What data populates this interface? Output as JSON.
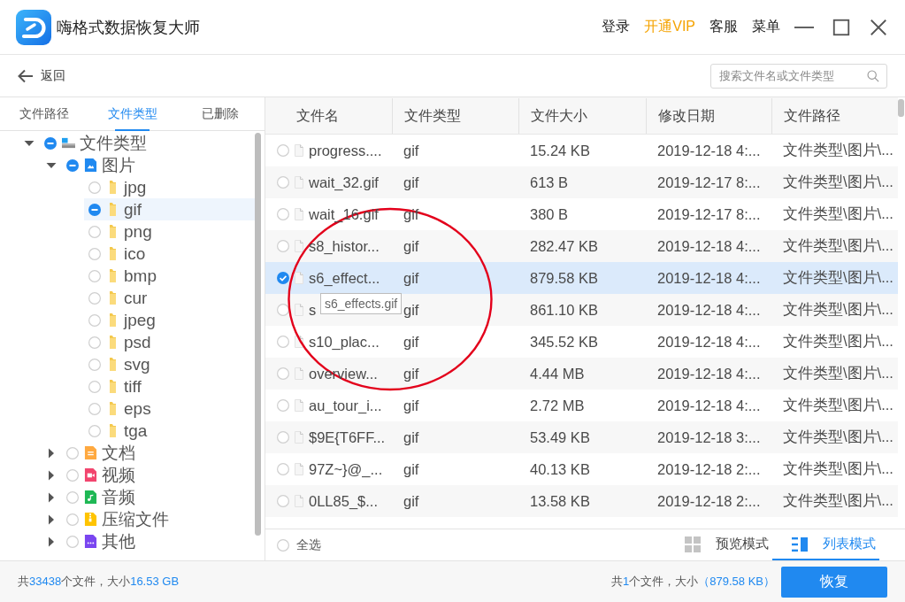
{
  "app": {
    "title": "嗨格式数据恢复大师",
    "nav": [
      {
        "label": "登录",
        "kind": "link"
      },
      {
        "label": "开通VIP",
        "kind": "vip"
      },
      {
        "label": "客服",
        "kind": "link"
      },
      {
        "label": "菜单",
        "kind": "link"
      }
    ]
  },
  "toolbar": {
    "back_label": "返回",
    "search": {
      "placeholder": "搜索文件名或文件类型"
    }
  },
  "sidebar": {
    "tabs": [
      {
        "label": "文件路径",
        "selected": false
      },
      {
        "label": "文件类型",
        "selected": true
      },
      {
        "label": "已删除",
        "selected": false
      }
    ],
    "tree": [
      {
        "label": "文件类型",
        "kind": "drive",
        "checked": false,
        "indeterminate": true,
        "expanded": true,
        "selected": false,
        "children": [
          {
            "label": "图片",
            "kind": "image",
            "checked": false,
            "indeterminate": true,
            "expanded": true,
            "selected": false,
            "children": [
              {
                "label": "jpg",
                "kind": "folder",
                "checked": false,
                "indeterminate": false,
                "selected": false
              },
              {
                "label": "gif",
                "kind": "folder",
                "checked": false,
                "indeterminate": true,
                "selected": true
              },
              {
                "label": "png",
                "kind": "folder",
                "checked": false,
                "indeterminate": false,
                "selected": false
              },
              {
                "label": "ico",
                "kind": "folder",
                "checked": false,
                "indeterminate": false,
                "selected": false
              },
              {
                "label": "bmp",
                "kind": "folder",
                "checked": false,
                "indeterminate": false,
                "selected": false
              },
              {
                "label": "cur",
                "kind": "folder",
                "checked": false,
                "indeterminate": false,
                "selected": false
              },
              {
                "label": "jpeg",
                "kind": "folder",
                "checked": false,
                "indeterminate": false,
                "selected": false
              },
              {
                "label": "psd",
                "kind": "folder",
                "checked": false,
                "indeterminate": false,
                "selected": false
              },
              {
                "label": "svg",
                "kind": "folder",
                "checked": false,
                "indeterminate": false,
                "selected": false
              },
              {
                "label": "tiff",
                "kind": "folder",
                "checked": false,
                "indeterminate": false,
                "selected": false
              },
              {
                "label": "eps",
                "kind": "folder",
                "checked": false,
                "indeterminate": false,
                "selected": false
              },
              {
                "label": "tga",
                "kind": "folder",
                "checked": false,
                "indeterminate": false,
                "selected": false
              }
            ]
          },
          {
            "label": "文档",
            "kind": "document",
            "checked": false,
            "indeterminate": false,
            "expanded": false,
            "selected": false
          },
          {
            "label": "视频",
            "kind": "video",
            "checked": false,
            "indeterminate": false,
            "expanded": false,
            "selected": false
          },
          {
            "label": "音频",
            "kind": "audio",
            "checked": false,
            "indeterminate": false,
            "expanded": false,
            "selected": false
          },
          {
            "label": "压缩文件",
            "kind": "archive",
            "checked": false,
            "indeterminate": false,
            "expanded": false,
            "selected": false
          },
          {
            "label": "其他",
            "kind": "other",
            "checked": false,
            "indeterminate": false,
            "expanded": false,
            "selected": false
          }
        ]
      }
    ]
  },
  "table": {
    "columns": [
      "文件名",
      "文件类型",
      "文件大小",
      "修改日期",
      "文件路径"
    ],
    "rows": [
      {
        "name": "progress....",
        "type": "gif",
        "size": "15.24 KB",
        "modified": "2019-12-18 4:...",
        "path": "文件类型\\图片\\...",
        "selected": false
      },
      {
        "name": "wait_32.gif",
        "type": "gif",
        "size": "613 B",
        "modified": "2019-12-17 8:...",
        "path": "文件类型\\图片\\...",
        "selected": false
      },
      {
        "name": "wait_16.gif",
        "type": "gif",
        "size": "380 B",
        "modified": "2019-12-17 8:...",
        "path": "文件类型\\图片\\...",
        "selected": false
      },
      {
        "name": "s8_histor...",
        "type": "gif",
        "size": "282.47 KB",
        "modified": "2019-12-18 4:...",
        "path": "文件类型\\图片\\...",
        "selected": false
      },
      {
        "name": "s6_effect...",
        "type": "gif",
        "size": "879.58 KB",
        "modified": "2019-12-18 4:...",
        "path": "文件类型\\图片\\...",
        "selected": true,
        "tooltip": "s6_effects.gif"
      },
      {
        "name": "s",
        "type": "gif",
        "size": "861.10 KB",
        "modified": "2019-12-18 4:...",
        "path": "文件类型\\图片\\...",
        "selected": false
      },
      {
        "name": "s10_plac...",
        "type": "gif",
        "size": "345.52 KB",
        "modified": "2019-12-18 4:...",
        "path": "文件类型\\图片\\...",
        "selected": false
      },
      {
        "name": "overview...",
        "type": "gif",
        "size": "4.44 MB",
        "modified": "2019-12-18 4:...",
        "path": "文件类型\\图片\\...",
        "selected": false
      },
      {
        "name": "au_tour_i...",
        "type": "gif",
        "size": "2.72 MB",
        "modified": "2019-12-18 4:...",
        "path": "文件类型\\图片\\...",
        "selected": false
      },
      {
        "name": "$9E{T6FF...",
        "type": "gif",
        "size": "53.49 KB",
        "modified": "2019-12-18 3:...",
        "path": "文件类型\\图片\\...",
        "selected": false
      },
      {
        "name": "97Z~}@_...",
        "type": "gif",
        "size": "40.13 KB",
        "modified": "2019-12-18 2:...",
        "path": "文件类型\\图片\\...",
        "selected": false
      },
      {
        "name": "0LL85_$...",
        "type": "gif",
        "size": "13.58 KB",
        "modified": "2019-12-18 2:...",
        "path": "文件类型\\图片\\...",
        "selected": false
      }
    ]
  },
  "list_footer": {
    "select_all": {
      "label": "全选",
      "checked": false
    },
    "view_modes": [
      {
        "label": "预览模式",
        "kind": "grid",
        "selected": false
      },
      {
        "label": "列表模式",
        "kind": "list",
        "selected": true
      }
    ]
  },
  "status_bar": {
    "total": [
      {
        "text": "共",
        "highlight": false
      },
      {
        "text": "33438",
        "highlight": true
      },
      {
        "text": "个文件，大小",
        "highlight": false
      },
      {
        "text": "16.53 GB",
        "highlight": true
      }
    ],
    "selection": [
      {
        "text": "共",
        "highlight": false
      },
      {
        "text": "1",
        "highlight": true
      },
      {
        "text": "个文件，大小",
        "highlight": false
      },
      {
        "text": "（879.58 KB）",
        "highlight": true
      }
    ],
    "recover_button": "恢复"
  }
}
